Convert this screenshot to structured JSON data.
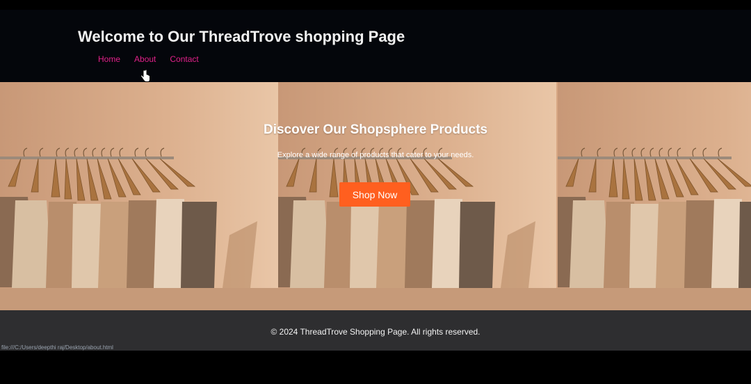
{
  "header": {
    "title": "Welcome to Our ThreadTrove shopping Page",
    "nav": [
      "Home",
      "About",
      "Contact"
    ]
  },
  "hero": {
    "title": "Discover Our Shopsphere Products",
    "subtitle": "Explore a wide range of products that cater to your needs.",
    "button_label": "Shop Now"
  },
  "footer": {
    "text": "© 2024 ThreadTrove Shopping Page. All rights reserved.",
    "status_url": "file:///C:/Users/deepthi raj/Desktop/about.html"
  },
  "colors": {
    "header_bg": "#04060b",
    "nav_link": "#e0218a",
    "button": "#ff5f1f",
    "footer_bg": "#2e2e30"
  },
  "icons": [
    "hand-pointer-cursor-icon"
  ]
}
